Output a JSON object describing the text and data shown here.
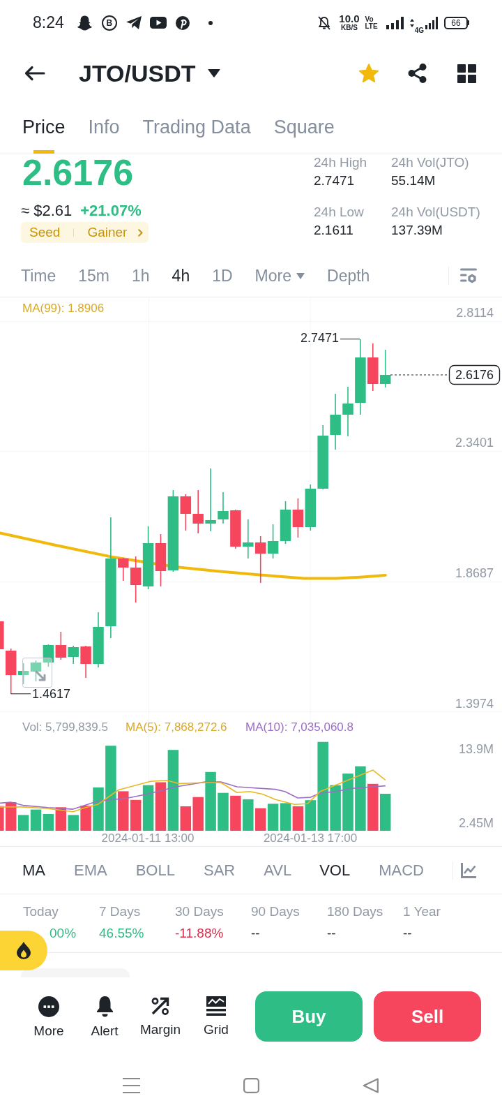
{
  "status_bar": {
    "time": "8:24",
    "app_letter": "B",
    "net_speed": "10.0",
    "net_unit": "KB/S",
    "volte": [
      "Vo",
      "LTE"
    ],
    "network": "4G",
    "battery": "66"
  },
  "header": {
    "title": "JTO/USDT",
    "favorite": true
  },
  "tabs": [
    {
      "label": "Price",
      "selected": true
    },
    {
      "label": "Info",
      "selected": false
    },
    {
      "label": "Trading Data",
      "selected": false
    },
    {
      "label": "Square",
      "selected": false
    }
  ],
  "ticker": {
    "last_price": "2.6176",
    "usd_price": "≈ $2.61",
    "change": "+21.07%",
    "tags": [
      "Seed",
      "Gainer"
    ],
    "stats": [
      {
        "label": "24h High",
        "value": "2.7471"
      },
      {
        "label": "24h Vol(JTO)",
        "value": "55.14M"
      },
      {
        "label": "24h Low",
        "value": "2.1611"
      },
      {
        "label": "24h Vol(USDT)",
        "value": "137.39M"
      }
    ]
  },
  "intervals": [
    {
      "label": "Time",
      "selected": false,
      "dropdown": false
    },
    {
      "label": "15m",
      "selected": false,
      "dropdown": false
    },
    {
      "label": "1h",
      "selected": false,
      "dropdown": false
    },
    {
      "label": "4h",
      "selected": true,
      "dropdown": false
    },
    {
      "label": "1D",
      "selected": false,
      "dropdown": false
    },
    {
      "label": "More",
      "selected": false,
      "dropdown": true
    },
    {
      "label": "Depth",
      "selected": false,
      "dropdown": false
    }
  ],
  "chart": {
    "ma_label": "MA(99): 1.8906",
    "price_labels": [
      "2.8114",
      "2.3401",
      "1.8687",
      "1.3974"
    ],
    "high_label": "2.7471",
    "low_label": "1.4617",
    "last_price": "2.6176"
  },
  "volume": {
    "vol_label": "Vol: 5,799,839.5",
    "ma5_label": "MA(5): 7,868,272.6",
    "ma10_label": "MA(10): 7,035,060.8",
    "axis_labels": [
      "13.9M",
      "2.45M"
    ],
    "time_labels": [
      "2024-01-11 13:00",
      "2024-01-13 17:00"
    ]
  },
  "indicators": {
    "main": [
      {
        "label": "MA",
        "selected": true
      },
      {
        "label": "EMA",
        "selected": false
      },
      {
        "label": "BOLL",
        "selected": false
      },
      {
        "label": "SAR",
        "selected": false
      },
      {
        "label": "AVL",
        "selected": false
      }
    ],
    "sub": [
      {
        "label": "VOL",
        "selected": true
      },
      {
        "label": "MACD",
        "selected": false
      }
    ]
  },
  "performance": [
    {
      "label": "Today",
      "value": "00%",
      "color": "#2ebd85"
    },
    {
      "label": "7 Days",
      "value": "46.55%",
      "color": "#2ebd85"
    },
    {
      "label": "30 Days",
      "value": "-11.88%",
      "color": "#d9304e"
    },
    {
      "label": "90 Days",
      "value": "--",
      "color": "#1e2329"
    },
    {
      "label": "180 Days",
      "value": "--",
      "color": "#1e2329"
    },
    {
      "label": "1 Year",
      "value": "--",
      "color": "#1e2329"
    }
  ],
  "actions": [
    {
      "label": "More",
      "kind": "more"
    },
    {
      "label": "Alert",
      "kind": "alert"
    },
    {
      "label": "Margin",
      "kind": "margin"
    },
    {
      "label": "Grid",
      "kind": "grid"
    }
  ],
  "trade_buttons": [
    {
      "label": "Buy",
      "kind": "buy"
    },
    {
      "label": "Sell",
      "kind": "sell"
    }
  ]
}
